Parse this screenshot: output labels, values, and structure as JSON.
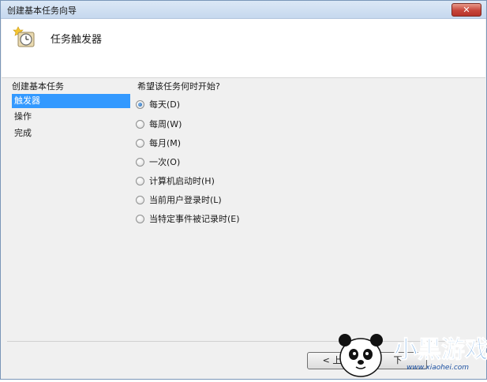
{
  "window": {
    "title": "创建基本任务向导",
    "close_label": "✕"
  },
  "header": {
    "title": "任务触发器",
    "icon": "scheduled-task-clock-icon"
  },
  "sidebar": {
    "heading": "创建基本任务",
    "items": [
      {
        "label": "触发器",
        "selected": true
      },
      {
        "label": "操作",
        "selected": false
      },
      {
        "label": "完成",
        "selected": false
      }
    ]
  },
  "content": {
    "question": "希望该任务何时开始?",
    "options": [
      {
        "label": "每天(D)",
        "checked": true
      },
      {
        "label": "每周(W)",
        "checked": false
      },
      {
        "label": "每月(M)",
        "checked": false
      },
      {
        "label": "一次(O)",
        "checked": false
      },
      {
        "label": "计算机启动时(H)",
        "checked": false
      },
      {
        "label": "当前用户登录时(L)",
        "checked": false
      },
      {
        "label": "当特定事件被记录时(E)",
        "checked": false
      }
    ]
  },
  "footer": {
    "back_label": "< 上一",
    "next_label": "下"
  },
  "watermark": {
    "text": "小黑游戏",
    "url": "www.xiaohei.com"
  },
  "colors": {
    "selection": "#3399ff",
    "title_bar": "#c6d8ee",
    "close": "#c6453a"
  }
}
